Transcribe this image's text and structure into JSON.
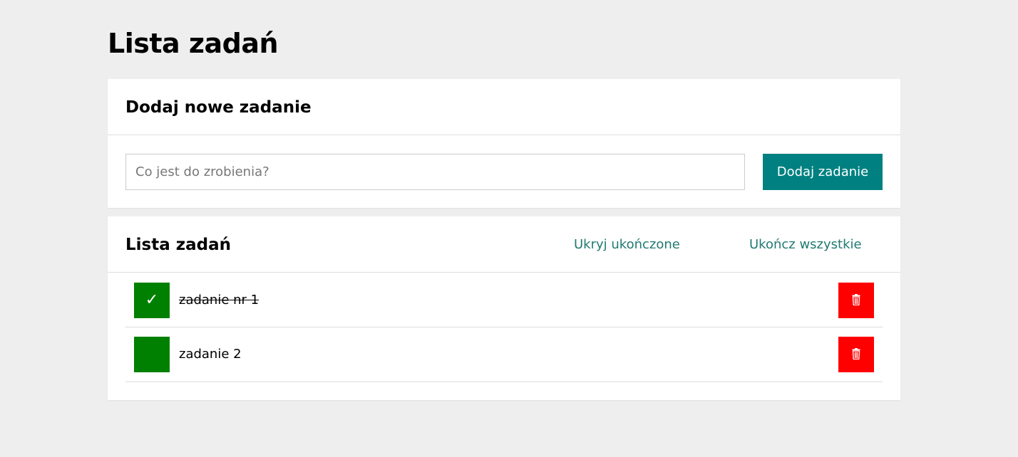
{
  "page": {
    "title": "Lista zadań"
  },
  "add_card": {
    "title": "Dodaj nowe zadanie",
    "input": {
      "value": "",
      "placeholder": "Co jest do zrobienia?"
    },
    "add_button_label": "Dodaj zadanie"
  },
  "list_card": {
    "title": "Lista zadań",
    "hide_completed_label": "Ukryj ukończone",
    "complete_all_label": "Ukończ wszystkie",
    "tasks": [
      {
        "text": "zadanie nr 1",
        "done": true,
        "check_glyph": "✓"
      },
      {
        "text": "zadanie 2",
        "done": false,
        "check_glyph": ""
      }
    ]
  },
  "icons": {
    "check": "check-icon",
    "delete": "trash-icon"
  },
  "colors": {
    "background": "#eeeeee",
    "accent": "#008080",
    "link": "#217a72",
    "checkbox": "#008000",
    "delete": "#ff0000"
  }
}
